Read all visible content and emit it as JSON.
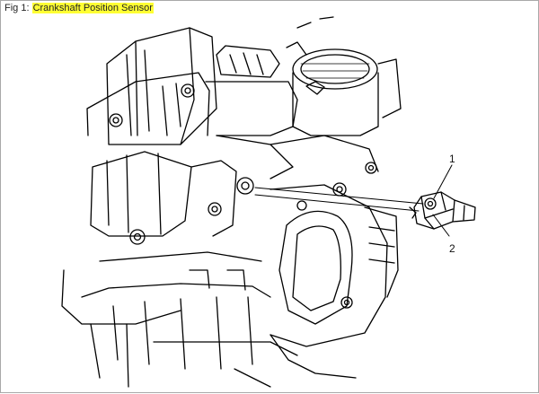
{
  "figure": {
    "prefix": "Fig 1:",
    "title": "Crankshaft Position Sensor"
  },
  "callouts": [
    {
      "number": "1"
    },
    {
      "number": "2"
    }
  ],
  "colors": {
    "highlight": "#ffff33",
    "line": "#000000",
    "frame": "#a9a9a9"
  }
}
